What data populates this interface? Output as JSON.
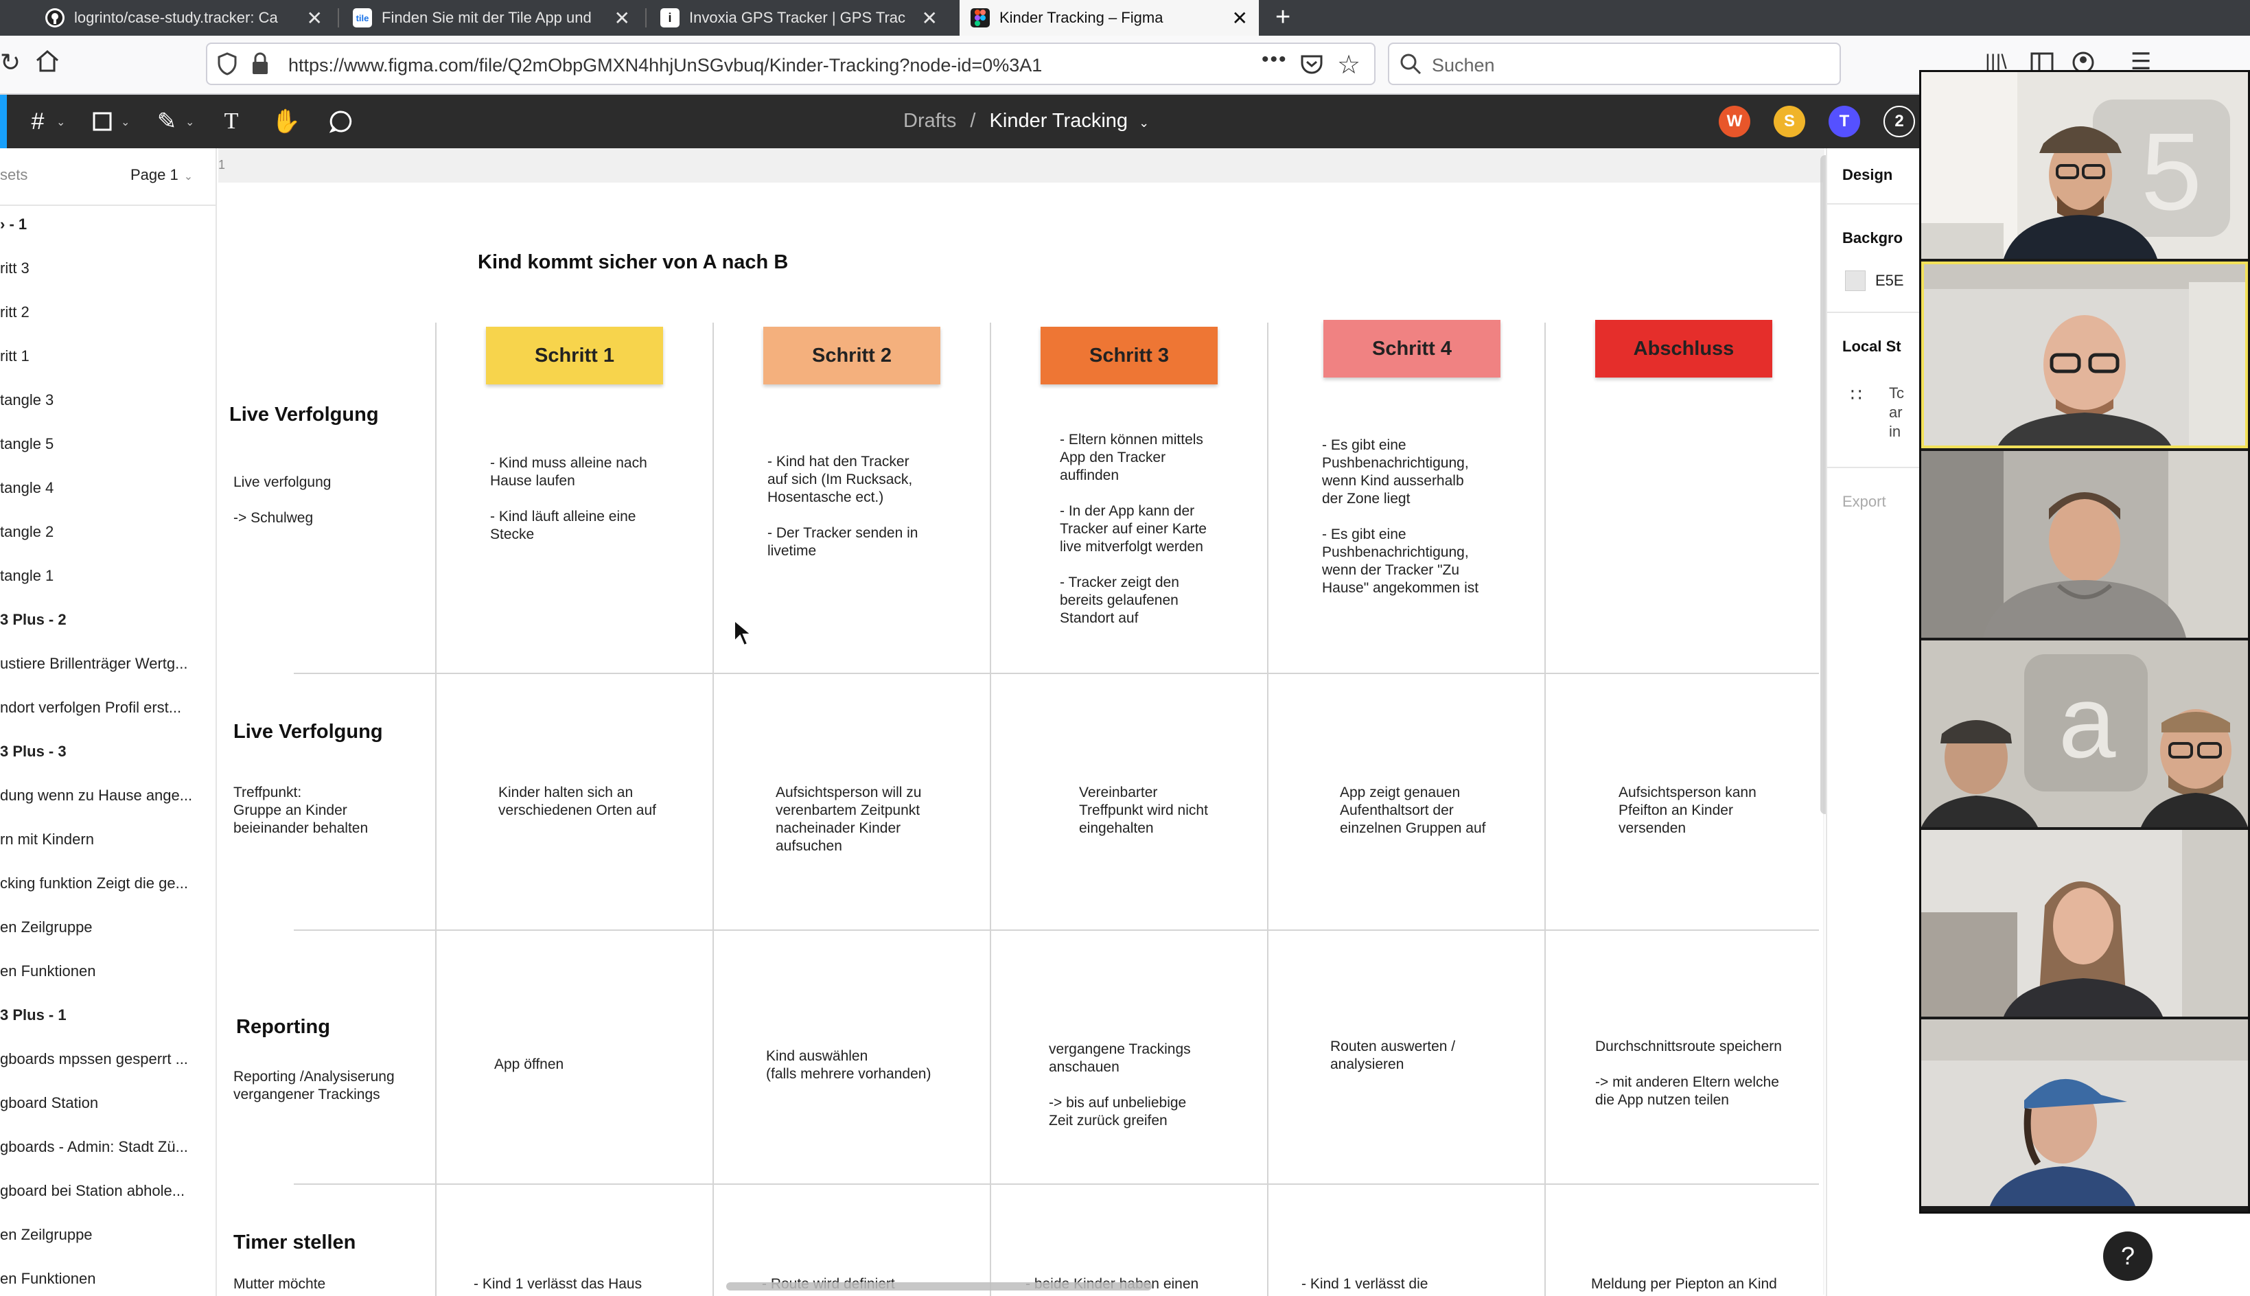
{
  "browser": {
    "tabs": [
      {
        "title": "logrinto/case-study.tracker: Ca",
        "active": false
      },
      {
        "title": "Finden Sie mit der Tile App und",
        "active": false
      },
      {
        "title": "Invoxia GPS Tracker | GPS Trac",
        "active": false
      },
      {
        "title": "Kinder Tracking – Figma",
        "active": true
      }
    ],
    "new_tab": "+",
    "url": "https://www.figma.com/file/Q2mObpGMXN4hhjUnSGvbuq/Kinder-Tracking?node-id=0%3A1",
    "search_placeholder": "Suchen",
    "tile_favicon_text": "tile"
  },
  "figma": {
    "breadcrumb": {
      "folder": "Drafts",
      "separator": "/",
      "file": "Kinder Tracking"
    },
    "avatars": [
      {
        "letter": "W",
        "color": "#e8562a"
      },
      {
        "letter": "S",
        "color": "#f0b429"
      },
      {
        "letter": "T",
        "color": "#5551ff"
      },
      {
        "letter": "2",
        "color": "#2c2c2c"
      }
    ]
  },
  "left_panel": {
    "assets_tab": "sets",
    "page": "Page 1",
    "layers": [
      {
        "label": "› - 1",
        "bold": true
      },
      {
        "label": "ritt 3",
        "bold": false
      },
      {
        "label": "ritt 2",
        "bold": false
      },
      {
        "label": "ritt 1",
        "bold": false
      },
      {
        "label": "tangle 3",
        "bold": false
      },
      {
        "label": "tangle 5",
        "bold": false
      },
      {
        "label": "tangle 4",
        "bold": false
      },
      {
        "label": "tangle 2",
        "bold": false
      },
      {
        "label": "tangle 1",
        "bold": false
      },
      {
        "label": "3 Plus - 2",
        "bold": true
      },
      {
        "label": "ustiere Brillenträger Wertg...",
        "bold": false
      },
      {
        "label": "ndort verfolgen Profil erst...",
        "bold": false
      },
      {
        "label": "3 Plus - 3",
        "bold": true
      },
      {
        "label": "dung wenn zu Hause ange...",
        "bold": false
      },
      {
        "label": "rn mit Kindern",
        "bold": false
      },
      {
        "label": "cking funktion Zeigt die ge...",
        "bold": false
      },
      {
        "label": "en Zeilgruppe",
        "bold": false
      },
      {
        "label": "en Funktionen",
        "bold": false
      },
      {
        "label": "3 Plus - 1",
        "bold": true
      },
      {
        "label": "gboards mpssen gesperrt ...",
        "bold": false
      },
      {
        "label": "gboard Station",
        "bold": false
      },
      {
        "label": "gboards - Admin: Stadt Zü...",
        "bold": false
      },
      {
        "label": "gboard bei Station abhole...",
        "bold": false
      },
      {
        "label": "en Zeilgruppe",
        "bold": false
      },
      {
        "label": "en Funktionen",
        "bold": false
      }
    ]
  },
  "canvas": {
    "ruler_mark": "1",
    "board_title": "Kind kommt sicher von A nach B",
    "steps": [
      {
        "label": "Schritt 1",
        "color": "#f7d44c"
      },
      {
        "label": "Schritt 2",
        "color": "#f4b07d"
      },
      {
        "label": "Schritt 3",
        "color": "#ee7634"
      },
      {
        "label": "Schritt 4",
        "color": "#f08282"
      },
      {
        "label": "Abschluss",
        "color": "#e52e2b"
      }
    ],
    "rows": [
      {
        "title": "Live Verfolgung",
        "subtitle": "Live verfolgung\n\n-> Schulweg",
        "cells": [
          "- Kind muss alleine nach\nHause laufen\n\n- Kind läuft alleine eine\nStecke",
          "- Kind hat den Tracker\nauf sich (Im Rucksack,\nHosentasche ect.)\n\n- Der Tracker senden in\nlivetime",
          "- Eltern können mittels\nApp den Tracker\nauffinden\n\n- In der App kann der\nTracker auf einer Karte\nlive mitverfolgt werden\n\n- Tracker zeigt den\nbereits gelaufenen\nStandort auf",
          "- Es gibt eine\nPushbenachrichtigung,\nwenn Kind ausserhalb\nder Zone liegt\n\n- Es gibt eine\nPushbenachrichtigung,\nwenn der Tracker \"Zu\nHause\" angekommen ist",
          ""
        ]
      },
      {
        "title": "Live Verfolgung",
        "subtitle": "Treffpunkt:\nGruppe an Kinder\nbeieinander behalten",
        "cells": [
          "Kinder halten sich an\nverschiedenen Orten auf",
          "Aufsichtsperson will zu\nverenbartem Zeitpunkt\nnacheinader Kinder\naufsuchen",
          "Vereinbarter\nTreffpunkt wird nicht\neingehalten",
          "App zeigt genauen\nAufenthaltsort der\neinzelnen Gruppen auf",
          "Aufsichtsperson kann\nPfeifton an Kinder\nversenden"
        ]
      },
      {
        "title": "Reporting",
        "subtitle": "Reporting /Analysiserung\nvergangener Trackings",
        "cells": [
          "App öffnen",
          "Kind auswählen\n(falls mehrere vorhanden)",
          "vergangene Trackings\nanschauen\n\n-> bis auf unbeliebige\nZeit zurück greifen",
          "Routen auswerten /\nanalysieren",
          "Durchschnittsroute speichern\n\n-> mit anderen Eltern welche\ndie App nutzen teilen"
        ]
      },
      {
        "title": "Timer stellen",
        "subtitle": "Mutter möchte",
        "cells": [
          "- Kind 1 verlässt das Haus",
          "- Route wird definiert",
          "- beide Kinder haben einen",
          "- Kind 1 verlässt die",
          "Meldung per Piepton an Kind"
        ]
      }
    ]
  },
  "right_panel": {
    "tab": "Design",
    "background_label": "Backgro",
    "background_value": "E5E",
    "local_styles": "Local St",
    "local_text_1": "Tc",
    "local_text_2": "ar",
    "local_text_3": "in",
    "export": "Export"
  },
  "help_button": "?",
  "video": {
    "participants": 6
  }
}
